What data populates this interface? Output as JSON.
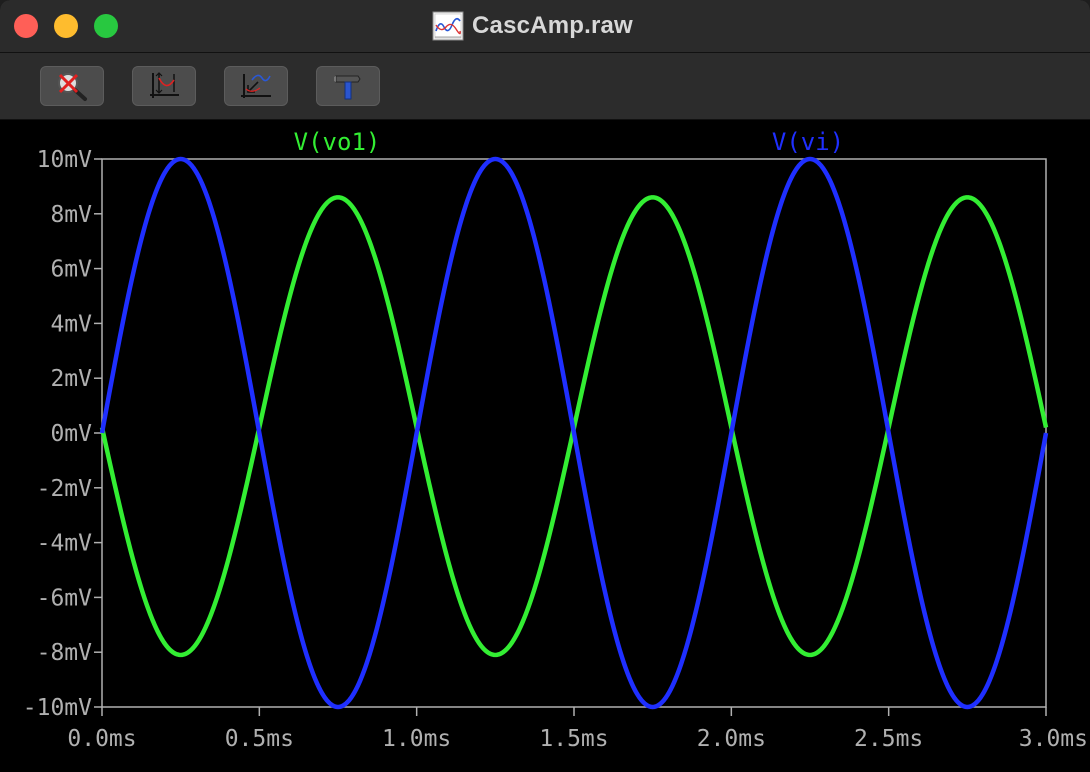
{
  "window": {
    "title": "CascAmp.raw",
    "icon": "waveform-document-icon"
  },
  "toolbar": {
    "buttons": [
      {
        "name": "zoom-cancel-button",
        "icon": "magnifier-cancel-icon"
      },
      {
        "name": "autorange-button",
        "icon": "autorange-axes-icon"
      },
      {
        "name": "zoom-back-button",
        "icon": "zoom-back-icon"
      },
      {
        "name": "tools-button",
        "icon": "hammer-icon"
      }
    ]
  },
  "chart_data": {
    "type": "line",
    "title": "",
    "xlabel": "",
    "ylabel": "",
    "xlim": [
      0.0,
      3.0
    ],
    "ylim": [
      -10,
      10
    ],
    "x_unit": "ms",
    "y_unit": "mV",
    "x_ticks": [
      "0.0ms",
      "0.5ms",
      "1.0ms",
      "1.5ms",
      "2.0ms",
      "2.5ms",
      "3.0ms"
    ],
    "y_ticks": [
      "10mV",
      "8mV",
      "6mV",
      "4mV",
      "2mV",
      "0mV",
      "-2mV",
      "-4mV",
      "-6mV",
      "-8mV",
      "-10mV"
    ],
    "grid": false,
    "background": "#000000",
    "axis_color": "#b0b0b0",
    "series": [
      {
        "name": "V(vo1)",
        "color": "#33ee33",
        "waveform": "sine",
        "frequency_khz": 1.0,
        "amplitude_mv": 8.3,
        "offset_mv": 0.2,
        "phase": "inverted",
        "x": [
          0.0,
          0.25,
          0.5,
          0.75,
          1.0,
          1.25,
          1.5,
          1.75,
          2.0,
          2.25,
          2.5,
          2.75,
          3.0
        ],
        "y": [
          0.2,
          -8.1,
          0.2,
          8.6,
          0.2,
          -8.1,
          0.2,
          8.6,
          0.2,
          -8.1,
          0.2,
          8.6,
          0.2
        ]
      },
      {
        "name": "V(vi)",
        "color": "#1f2fff",
        "waveform": "sine",
        "frequency_khz": 1.0,
        "amplitude_mv": 10.0,
        "offset_mv": 0.0,
        "phase": "normal",
        "x": [
          0.0,
          0.25,
          0.5,
          0.75,
          1.0,
          1.25,
          1.5,
          1.75,
          2.0,
          2.25,
          2.5,
          2.75,
          3.0
        ],
        "y": [
          0.0,
          10.0,
          0.0,
          -10.0,
          0.0,
          10.0,
          0.0,
          -10.0,
          0.0,
          10.0,
          0.0,
          -10.0,
          0.0
        ]
      }
    ]
  }
}
